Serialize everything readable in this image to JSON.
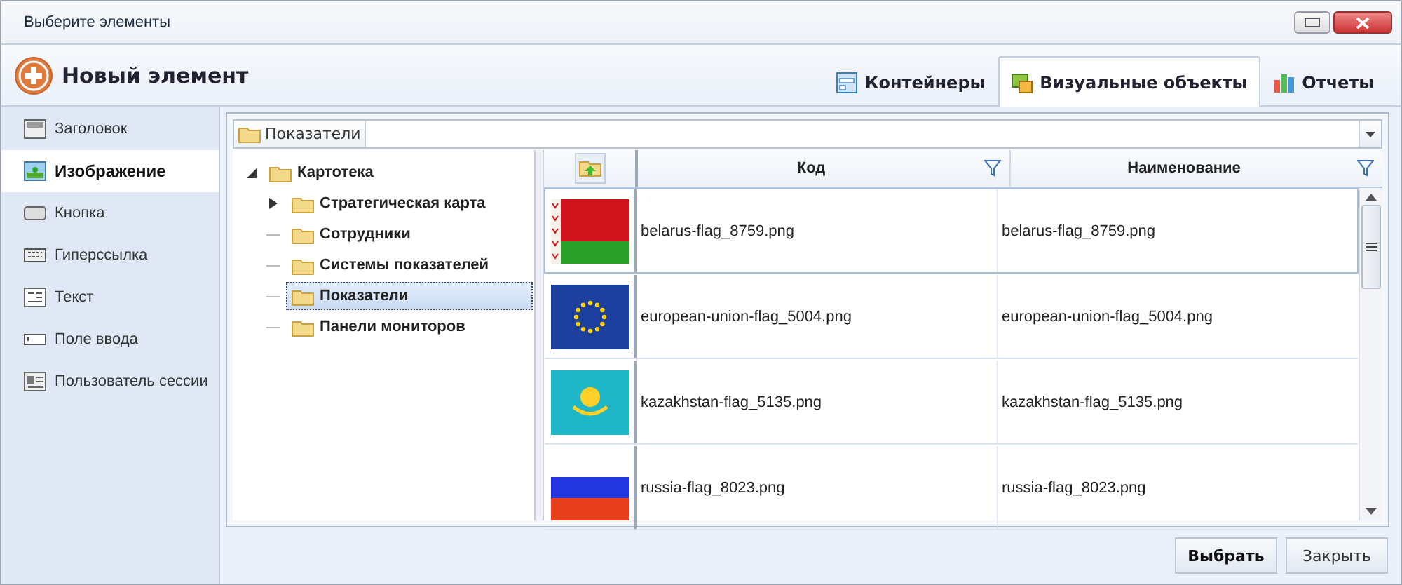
{
  "window": {
    "title": "Выберите элементы"
  },
  "header": {
    "new_button": "Новый элемент"
  },
  "tabs": [
    {
      "label": "Контейнеры",
      "kind": "containers",
      "selected": false
    },
    {
      "label": "Визуальные объекты",
      "kind": "visual",
      "selected": true
    },
    {
      "label": "Отчеты",
      "kind": "reports",
      "selected": false
    }
  ],
  "sidebar": {
    "items": [
      {
        "label": "Заголовок",
        "kind": "header",
        "selected": false
      },
      {
        "label": "Изображение",
        "kind": "image",
        "selected": true
      },
      {
        "label": "Кнопка",
        "kind": "button",
        "selected": false
      },
      {
        "label": "Гиперссылка",
        "kind": "link",
        "selected": false
      },
      {
        "label": "Текст",
        "kind": "text",
        "selected": false
      },
      {
        "label": "Поле ввода",
        "kind": "input",
        "selected": false
      },
      {
        "label": "Пользователь сессии",
        "kind": "user",
        "selected": false
      }
    ]
  },
  "breadcrumb": [
    "Показатели"
  ],
  "tree": [
    {
      "label": "Картотека",
      "expanded": true,
      "selected": false,
      "children": [
        {
          "label": "Стратегическая карта",
          "expanded": false,
          "selected": false
        },
        {
          "label": "Сотрудники",
          "selected": false
        },
        {
          "label": "Системы показателей",
          "selected": false
        },
        {
          "label": "Показатели",
          "selected": true
        },
        {
          "label": "Панели мониторов",
          "selected": false
        }
      ]
    }
  ],
  "table": {
    "columns": [
      "Код",
      "Наименование"
    ],
    "rows": [
      {
        "kind": "bicolor",
        "code": "belarus-flag_8759.png",
        "name": "belarus-flag_8759.png",
        "selected": true
      },
      {
        "kind": "stars",
        "code": "european-union-flag_5004.png",
        "name": "european-union-flag_5004.png",
        "selected": false
      },
      {
        "kind": "emblem",
        "code": "kazakhstan-flag_5135.png",
        "name": "kazakhstan-flag_5135.png",
        "selected": false
      },
      {
        "kind": "tricolor",
        "code": "russia-flag_8023.png",
        "name": "russia-flag_8023.png",
        "selected": false
      }
    ]
  },
  "buttons": [
    "Выбрать",
    "Закрыть"
  ]
}
